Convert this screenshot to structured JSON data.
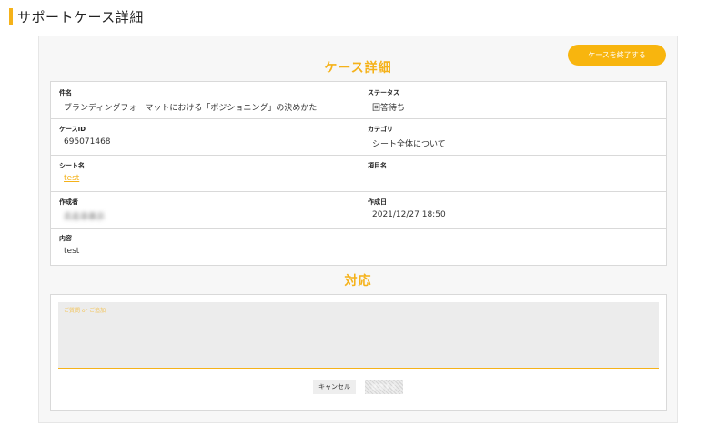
{
  "page": {
    "title": "サポートケース詳細"
  },
  "actions": {
    "end_case_label": "ケースを終了する"
  },
  "detail": {
    "heading": "ケース詳細",
    "subject": {
      "label": "件名",
      "value": "ブランディングフォーマットにおける「ポジショニング」の決めかた"
    },
    "status": {
      "label": "ステータス",
      "value": "回答待ち"
    },
    "case_id": {
      "label": "ケースID",
      "value": "695071468"
    },
    "category": {
      "label": "カテゴリ",
      "value": "シート全体について"
    },
    "sheet_name": {
      "label": "シート名",
      "value": "test"
    },
    "item_name": {
      "label": "項目名",
      "value": ""
    },
    "author": {
      "label": "作成者",
      "value": "氏名非表示"
    },
    "created_at": {
      "label": "作成日",
      "value": "2021/12/27 18:50"
    },
    "content": {
      "label": "内容",
      "value": "test"
    }
  },
  "response": {
    "heading": "対応",
    "placeholder": "ご質問 or ご追加",
    "cancel_label": "キャンセル",
    "submit_label": "送信する"
  },
  "colors": {
    "accent": "#f5b21a",
    "button": "#f8b50e"
  }
}
